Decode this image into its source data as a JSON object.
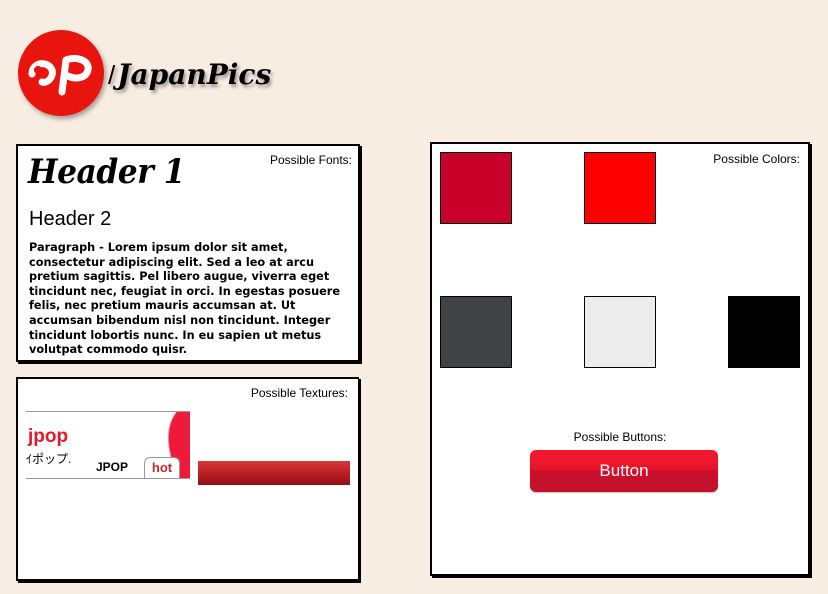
{
  "logo": {
    "mark_text": "JP",
    "slash": "/",
    "name": "JapanPics",
    "mark_color": "#e8140e"
  },
  "fonts_panel": {
    "label": "Possible Fonts:",
    "header1": "Header 1",
    "header2": "Header 2",
    "paragraph": "Paragraph - Lorem ipsum dolor sit amet, consectetur adipiscing elit. Sed a leo at arcu pretium sagittis. Pel libero augue, viverra eget tincidunt nec, feugiat in orci. In egestas posuere felis, nec pretium mauris accumsan at. Ut accumsan bibendum nisl non tincidunt. Integer tincidunt lobortis nunc. In eu sapien ut metus volutpat commodo quisr."
  },
  "textures_panel": {
    "label": "Possible Textures:",
    "sample_title": "jpop",
    "sample_subtitle": "ｲポップ.",
    "tab_inactive": "JPOP",
    "tab_active": "hot"
  },
  "colors_panel": {
    "label": "Possible Colors:",
    "swatches": [
      "#c8002a",
      "#ff0000",
      "#404446",
      "#ececec",
      "#000000"
    ],
    "buttons_label": "Possible Buttons:",
    "button_label": "Button"
  }
}
